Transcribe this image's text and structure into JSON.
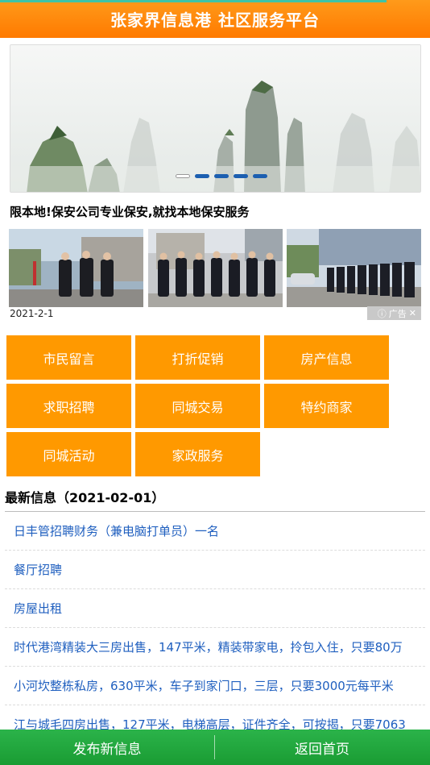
{
  "header": {
    "title": "张家界信息港 社区服务平台"
  },
  "banner": {
    "slide_count": 5,
    "active_index": 0
  },
  "ad": {
    "title": "限本地!保安公司专业保安,就找本地保安服务",
    "date": "2021-2-1",
    "tag_label": "广告",
    "close_glyph": "✕"
  },
  "categories": [
    {
      "label": "市民留言"
    },
    {
      "label": "打折促销"
    },
    {
      "label": "房产信息"
    },
    {
      "label": "求职招聘"
    },
    {
      "label": "同城交易"
    },
    {
      "label": "特约商家"
    },
    {
      "label": "同城活动"
    },
    {
      "label": "家政服务"
    }
  ],
  "latest": {
    "title": "最新信息（2021-02-01）",
    "items": [
      "日丰管招聘财务（兼电脑打单员）一名",
      "餐厅招聘",
      "房屋出租",
      "时代港湾精装大三房出售，147平米，精装带家电，拎包入住，只要80万",
      "小河坎整栋私房，630平米，车子到家门口，三层，只要3000元每平米",
      "江与城毛四房出售，127平米，电梯高层，证件齐全，可按揭，只要7063"
    ]
  },
  "footer": {
    "publish_label": "发布新信息",
    "home_label": "返回首页"
  },
  "colors": {
    "header": "#ff8000",
    "tile": "#ff9900",
    "link": "#1f5fbf",
    "footer": "#22a83f"
  }
}
